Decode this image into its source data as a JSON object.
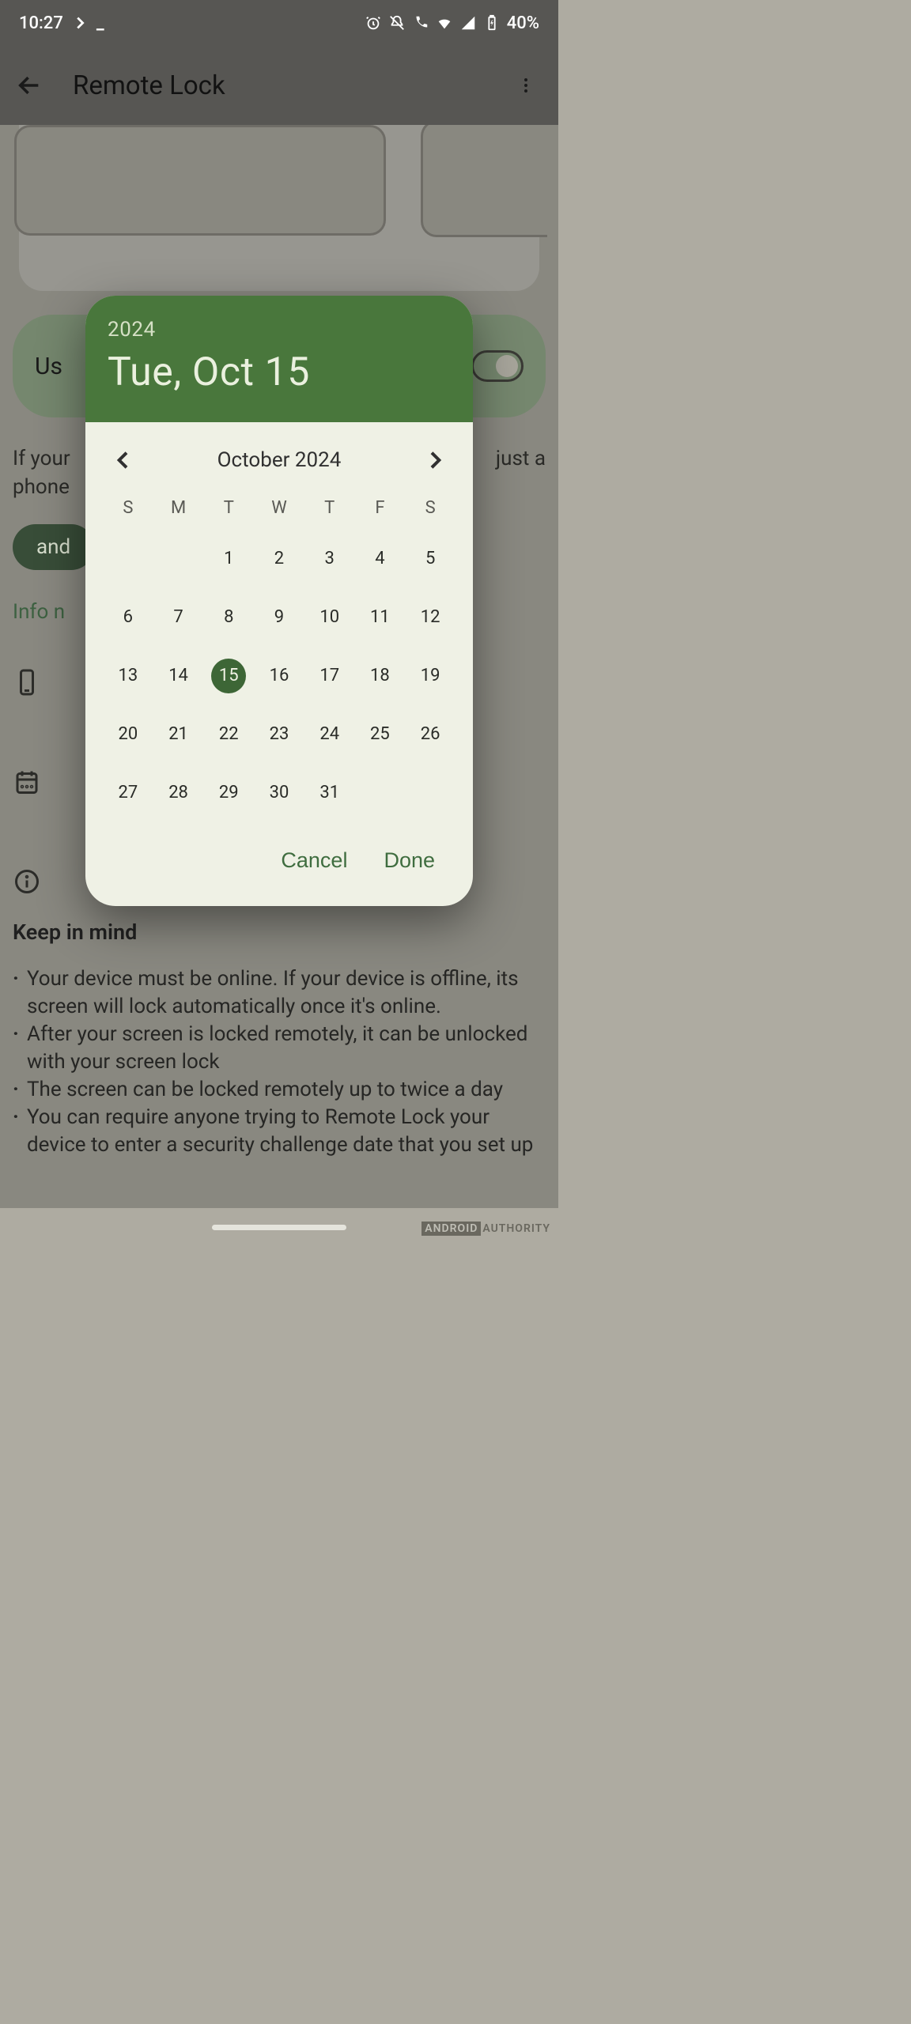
{
  "status": {
    "time": "10:27",
    "battery": "40%"
  },
  "appbar": {
    "title": "Remote Lock"
  },
  "background": {
    "toggle_label": "Us",
    "body_text1": "If your",
    "body_text2": "just a",
    "body_text3": "phone",
    "pill_label": "and",
    "info_link": "Info n",
    "keep_heading": "Keep in mind",
    "bullets": [
      "Your device must be online. If your device is offline, its screen will lock automatically once it's online.",
      "After your screen is locked remotely, it can be unlocked with your screen lock",
      "The screen can be locked remotely up to twice a day",
      "You can require anyone trying to Remote Lock your device to enter a security challenge date that you set up"
    ]
  },
  "watermark": {
    "a": "ANDROID",
    "b": "AUTHORITY"
  },
  "dialog": {
    "year": "2024",
    "date_long": "Tue, Oct 15",
    "month_title": "October 2024",
    "days_of_week": [
      "S",
      "M",
      "T",
      "W",
      "T",
      "F",
      "S"
    ],
    "leading_blanks": 2,
    "days_in_month": 31,
    "selected_day": 15,
    "cancel_label": "Cancel",
    "done_label": "Done"
  }
}
